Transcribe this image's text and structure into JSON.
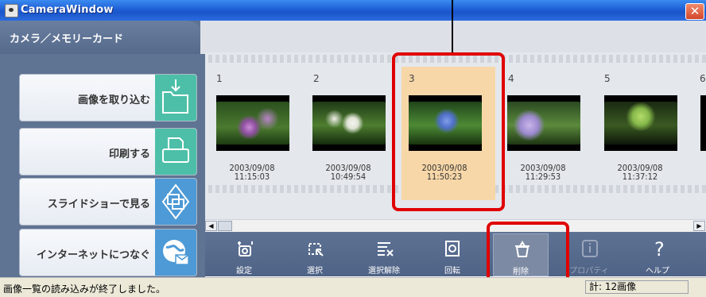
{
  "window": {
    "title": "CameraWindow",
    "close": "✕"
  },
  "left_panel": {
    "header": "カメラ／メモリーカード",
    "buttons": [
      {
        "label": "画像を取り込む",
        "icon": "folder-import-icon",
        "color": "#4dbfa8"
      },
      {
        "label": "印刷する",
        "icon": "print-icon",
        "color": "#4dbfa8"
      },
      {
        "label": "スライドショーで見る",
        "icon": "slideshow-icon",
        "color": "#4d9ad6"
      },
      {
        "label": "インターネットにつなぐ",
        "icon": "internet-icon",
        "color": "#4d9ad6"
      }
    ]
  },
  "thumbnails": [
    {
      "index": "1",
      "date": "2003/09/08",
      "time": "11:15:03"
    },
    {
      "index": "2",
      "date": "2003/09/08",
      "time": "10:49:54"
    },
    {
      "index": "3",
      "date": "2003/09/08",
      "time": "11:50:23",
      "selected": true
    },
    {
      "index": "4",
      "date": "2003/09/08",
      "time": "11:29:53"
    },
    {
      "index": "5",
      "date": "2003/09/08",
      "time": "11:37:12"
    },
    {
      "index": "6"
    }
  ],
  "toolbar": [
    {
      "label": "設定",
      "icon": "settings-icon"
    },
    {
      "label": "選択",
      "icon": "select-icon"
    },
    {
      "label": "選択解除",
      "icon": "deselect-icon"
    },
    {
      "label": "回転",
      "icon": "rotate-icon"
    },
    {
      "label": "削除",
      "icon": "trash-icon",
      "active": true
    },
    {
      "label": "プロパティ",
      "icon": "info-icon",
      "disabled": true
    },
    {
      "label": "ヘルプ",
      "icon": "help-icon"
    }
  ],
  "status": {
    "message": "画像一覧の読み込みが終了しました。",
    "count": "計: 12画像"
  },
  "colors": {
    "title_bar": "#1f5fd6",
    "panel": "#5f7393",
    "selection": "#f7d7a8",
    "highlight": "#e00000"
  }
}
